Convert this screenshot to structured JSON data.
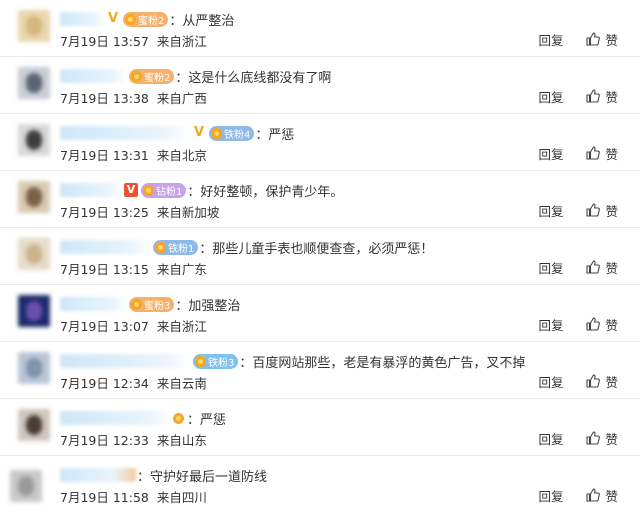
{
  "comments": [
    {
      "vmark": "V",
      "vmark_style": "gold",
      "badge": "蜜粉2",
      "badge_color": "orange",
      "text": "：从严整治",
      "time": "7月19日 13:57",
      "loc": "来自浙江"
    },
    {
      "vmark": "",
      "vmark_style": "",
      "badge": "蜜粉2",
      "badge_color": "orange",
      "text": "：这是什么底线都没有了啊",
      "time": "7月19日 13:38",
      "loc": "来自广西"
    },
    {
      "vmark": "V",
      "vmark_style": "gold",
      "badge": "铁粉4",
      "badge_color": "blue",
      "text": "：严惩",
      "time": "7月19日 13:31",
      "loc": "来自北京"
    },
    {
      "vmark": "V",
      "vmark_style": "red",
      "badge": "钻粉1",
      "badge_color": "purple",
      "text": "：好好整顿，保护青少年。",
      "time": "7月19日 13:25",
      "loc": "来自新加坡"
    },
    {
      "vmark": "",
      "vmark_style": "",
      "badge": "铁粉1",
      "badge_color": "blue",
      "text": "：那些儿童手表也顺便查查，必须严惩！",
      "time": "7月19日 13:15",
      "loc": "来自广东"
    },
    {
      "vmark": "",
      "vmark_style": "",
      "badge": "蜜粉3",
      "badge_color": "orange",
      "text": "：加强整治",
      "time": "7月19日 13:07",
      "loc": "来自浙江"
    },
    {
      "vmark": "",
      "vmark_style": "",
      "badge": "铁粉3",
      "badge_color": "cyan",
      "text": "：百度网站那些，老是有暴浮的黄色广告，叉不掉",
      "time": "7月19日 12:34",
      "loc": "来自云南"
    },
    {
      "vmark": "",
      "vmark_style": "",
      "badge": "",
      "badge_color": "",
      "text": "：严惩",
      "time": "7月19日 12:33",
      "loc": "来自山东"
    },
    {
      "vmark": "",
      "vmark_style": "",
      "badge": "",
      "badge_color": "",
      "text": "：守护好最后一道防线",
      "time": "7月19日 11:58",
      "loc": "来自四川"
    }
  ],
  "actions": {
    "reply_label": "回复",
    "like_label": "赞"
  },
  "icons": {
    "like": "thumbs-up-icon"
  }
}
